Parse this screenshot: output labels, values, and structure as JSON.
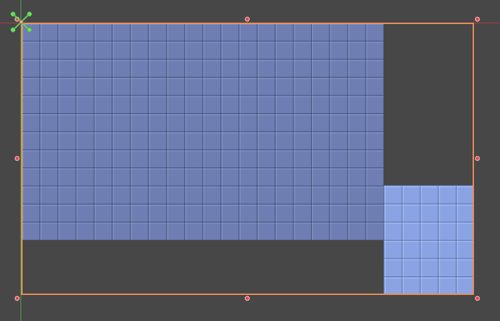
{
  "canvas": {
    "background_color": "#474747",
    "axis_x_color": "#b33b3b",
    "axis_y_color": "#4caf3f"
  },
  "tiles": {
    "main_color": "#6e7eb2",
    "selected_color": "#8aa3e3"
  },
  "selection": {
    "border_color": "#f08d55",
    "handle_color": "#e8424a"
  },
  "pivot": {
    "icon": "move-pivot-icon",
    "color": "#5fcf5a"
  }
}
